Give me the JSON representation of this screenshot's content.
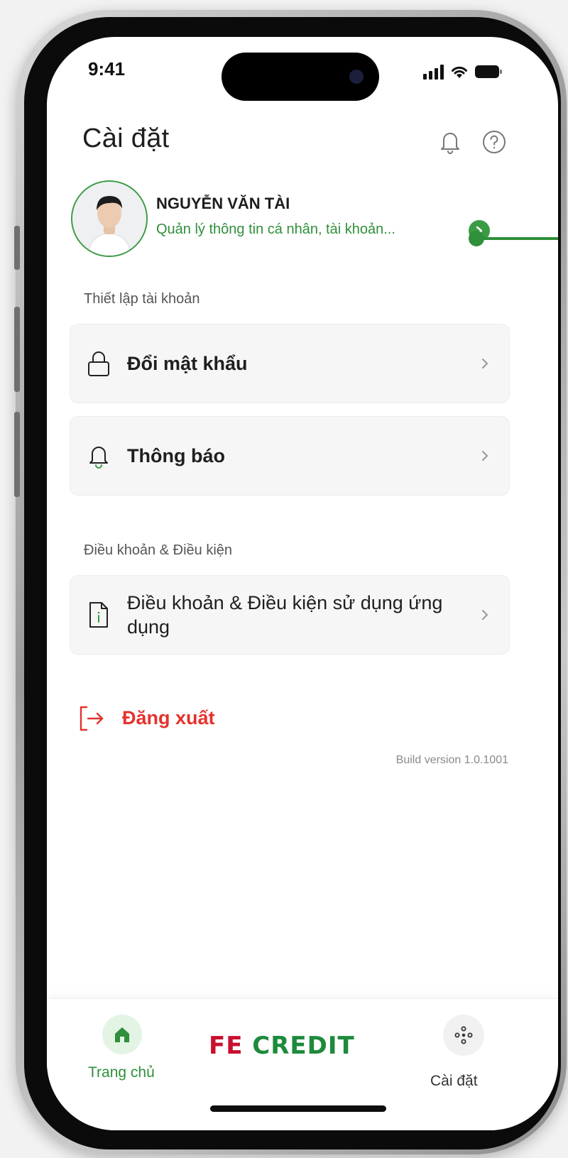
{
  "status_bar": {
    "time": "9:41"
  },
  "header": {
    "title": "Cài đặt",
    "notification_icon": "bell-icon",
    "help_icon": "help-circle-icon"
  },
  "profile": {
    "name": "NGUYỄN VĂN TÀI",
    "subtitle": "Quản lý thông tin cá nhân, tài khoản...",
    "avatar_icon": "user-photo"
  },
  "sections": {
    "account": {
      "label": "Thiết lập tài khoản",
      "items": [
        {
          "label": "Đổi mật khẩu",
          "icon": "lock-icon"
        },
        {
          "label": "Thông báo",
          "icon": "bell-icon"
        }
      ]
    },
    "terms": {
      "label": "Điều khoản & Điều kiện",
      "items": [
        {
          "label": "Điều khoản & Điều kiện sử dụng ứng dụng",
          "icon": "document-info-icon"
        }
      ]
    }
  },
  "logout": {
    "label": "Đăng xuất",
    "icon": "logout-icon",
    "color": "#e5322d"
  },
  "build_version": "Build version 1.0.1001",
  "bottom_nav": {
    "home_label": "Trang chủ",
    "brand_part1": "FE",
    "brand_part2": "CREDIT",
    "settings_label": "Cài đặt"
  },
  "colors": {
    "accent": "#2f8f3a",
    "danger": "#e5322d",
    "brand_red": "#c8102e",
    "brand_green": "#1d8a3c"
  }
}
